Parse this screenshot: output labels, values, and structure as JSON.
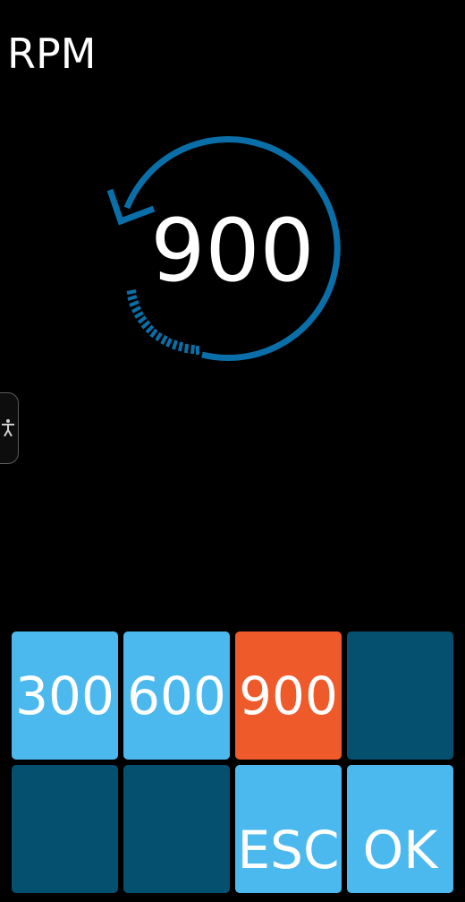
{
  "header": {
    "title": "RPM"
  },
  "gauge": {
    "value": "900",
    "accent_color": "#0a6fa8",
    "direction_icon": "counterclockwise-arrow-icon"
  },
  "accessibility": {
    "icon": "accessibility-person-icon"
  },
  "keypad": {
    "colors": {
      "light": "#4bb9ee",
      "selected": "#ef5a2a",
      "empty": "#05506e"
    },
    "keys": [
      {
        "label": "300"
      },
      {
        "label": "600"
      },
      {
        "label": "900",
        "selected": true
      },
      {
        "label": ""
      },
      {
        "label": ""
      },
      {
        "label": ""
      },
      {
        "label": "ESC"
      },
      {
        "label": "OK"
      }
    ]
  }
}
